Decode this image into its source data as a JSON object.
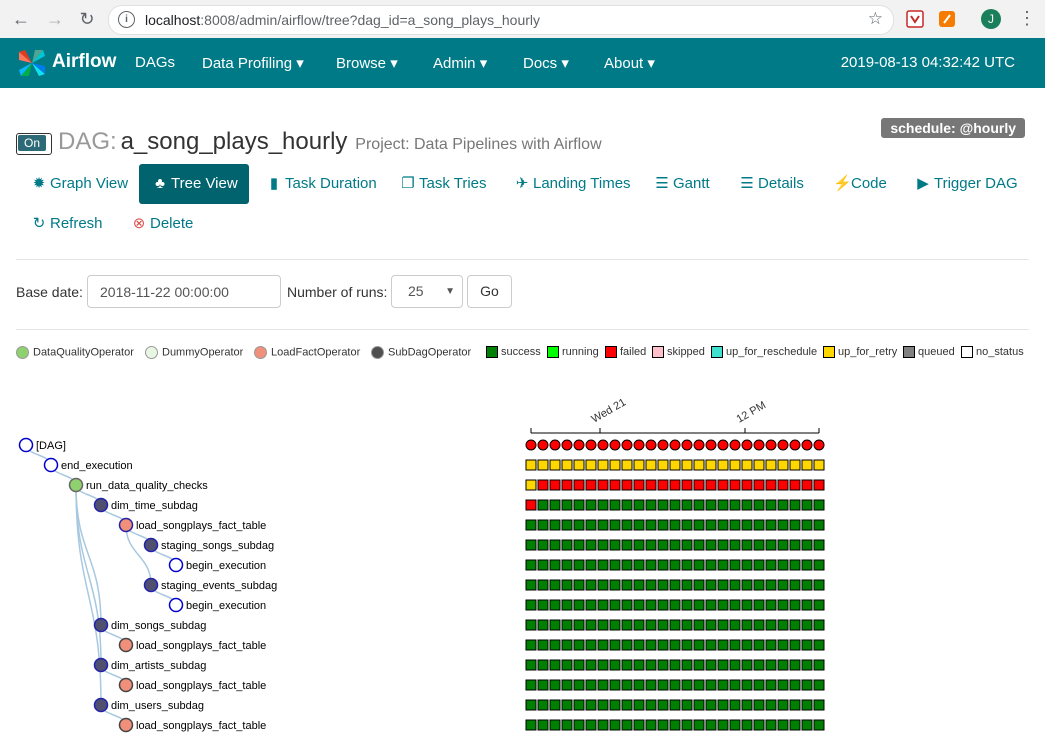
{
  "browser": {
    "url_prefix": "localhost",
    "url_rest": ":8008/admin/airflow/tree?dag_id=a_song_plays_hourly",
    "avatar_letter": "J"
  },
  "navbar": {
    "brand": "Airflow",
    "items": [
      {
        "label": "DAGs"
      },
      {
        "label": "Data Profiling"
      },
      {
        "label": "Browse"
      },
      {
        "label": "Admin"
      },
      {
        "label": "Docs"
      },
      {
        "label": "About"
      }
    ],
    "time": "2019-08-13 04:32:42 UTC"
  },
  "dag": {
    "toggle": "On",
    "label": "DAG:",
    "name": "a_song_plays_hourly",
    "project": "Project: Data Pipelines with Airflow",
    "schedule": "schedule: @hourly"
  },
  "tabs": [
    {
      "label": "Graph View",
      "icon": "sun-icon"
    },
    {
      "label": "Tree View",
      "icon": "tree-icon"
    },
    {
      "label": "Task Duration",
      "icon": "bar-chart-icon"
    },
    {
      "label": "Task Tries",
      "icon": "duplicate-icon"
    },
    {
      "label": "Landing Times",
      "icon": "plane-icon"
    },
    {
      "label": "Gantt",
      "icon": "align-left-icon"
    },
    {
      "label": "Details",
      "icon": "list-icon"
    },
    {
      "label": "Code",
      "icon": "flash-icon"
    },
    {
      "label": "Trigger DAG",
      "icon": "play-circle-icon"
    },
    {
      "label": "Refresh",
      "icon": "refresh-icon"
    },
    {
      "label": "Delete",
      "icon": "remove-circle-icon"
    }
  ],
  "form": {
    "base_date_label": "Base date:",
    "base_date_value": "2018-11-22 00:00:00",
    "runs_label": "Number of runs:",
    "runs_value": "25",
    "go_label": "Go"
  },
  "operator_legend": [
    {
      "label": "DataQualityOperator",
      "color": "#8fd16e"
    },
    {
      "label": "DummyOperator",
      "color": "#e8f7e4"
    },
    {
      "label": "LoadFactOperator",
      "color": "#f0907a"
    },
    {
      "label": "SubDagOperator",
      "color": "#4f4f4f"
    }
  ],
  "state_legend": [
    {
      "label": "success",
      "color": "#008000"
    },
    {
      "label": "running",
      "color": "#00ff00"
    },
    {
      "label": "failed",
      "color": "#ff0000"
    },
    {
      "label": "skipped",
      "color": "#ffc0cb"
    },
    {
      "label": "up_for_reschedule",
      "color": "#40e0d0"
    },
    {
      "label": "up_for_retry",
      "color": "#ffd700"
    },
    {
      "label": "queued",
      "color": "#808080"
    },
    {
      "label": "no_status",
      "color": "#ffffff"
    }
  ],
  "tree": {
    "time_axis": [
      "Wed 21",
      "12 PM"
    ],
    "run_count": 25,
    "nodes": [
      {
        "label": "[DAG]",
        "depth": 0,
        "fill": "#ffffff",
        "stroke": "#0000cc"
      },
      {
        "label": "end_execution",
        "depth": 1,
        "fill": "#ffffff",
        "stroke": "#0000cc"
      },
      {
        "label": "run_data_quality_checks",
        "depth": 2,
        "fill": "#8fd16e",
        "stroke": "#666666"
      },
      {
        "label": "dim_time_subdag",
        "depth": 3,
        "fill": "#4f4f70",
        "stroke": "#2222aa"
      },
      {
        "label": "load_songplays_fact_table",
        "depth": 4,
        "fill": "#f0907a",
        "stroke": "#2222aa"
      },
      {
        "label": "staging_songs_subdag",
        "depth": 5,
        "fill": "#4f4f70",
        "stroke": "#2222aa"
      },
      {
        "label": "begin_execution",
        "depth": 6,
        "fill": "#ffffff",
        "stroke": "#0000cc"
      },
      {
        "label": "staging_events_subdag",
        "depth": 5,
        "fill": "#4f4f70",
        "stroke": "#2222aa"
      },
      {
        "label": "begin_execution",
        "depth": 6,
        "fill": "#ffffff",
        "stroke": "#0000cc"
      },
      {
        "label": "dim_songs_subdag",
        "depth": 3,
        "fill": "#4f4f70",
        "stroke": "#2222aa"
      },
      {
        "label": "load_songplays_fact_table",
        "depth": 4,
        "fill": "#f0907a",
        "stroke": "#444444"
      },
      {
        "label": "dim_artists_subdag",
        "depth": 3,
        "fill": "#4f4f70",
        "stroke": "#2222aa"
      },
      {
        "label": "load_songplays_fact_table",
        "depth": 4,
        "fill": "#f0907a",
        "stroke": "#444444"
      },
      {
        "label": "dim_users_subdag",
        "depth": 3,
        "fill": "#4f4f70",
        "stroke": "#2222aa"
      },
      {
        "label": "load_songplays_fact_table",
        "depth": 4,
        "fill": "#f0907a",
        "stroke": "#444444"
      }
    ],
    "rows": [
      {
        "kind": "dagrun",
        "states": [
          "failed"
        ],
        "first": null
      },
      {
        "kind": "task",
        "states": [
          "up_for_retry"
        ],
        "first": null
      },
      {
        "kind": "task",
        "states": [
          "failed"
        ],
        "first": "up_for_retry"
      },
      {
        "kind": "task",
        "states": [
          "success"
        ],
        "first": "failed"
      },
      {
        "kind": "task",
        "states": [
          "success"
        ],
        "first": null
      },
      {
        "kind": "task",
        "states": [
          "success"
        ],
        "first": null
      },
      {
        "kind": "task",
        "states": [
          "success"
        ],
        "first": null
      },
      {
        "kind": "task",
        "states": [
          "success"
        ],
        "first": null
      },
      {
        "kind": "task",
        "states": [
          "success"
        ],
        "first": null
      },
      {
        "kind": "task",
        "states": [
          "success"
        ],
        "first": null
      },
      {
        "kind": "task",
        "states": [
          "success"
        ],
        "first": null
      },
      {
        "kind": "task",
        "states": [
          "success"
        ],
        "first": null
      },
      {
        "kind": "task",
        "states": [
          "success"
        ],
        "first": null
      },
      {
        "kind": "task",
        "states": [
          "success"
        ],
        "first": null
      },
      {
        "kind": "task",
        "states": [
          "success"
        ],
        "first": null
      }
    ]
  }
}
